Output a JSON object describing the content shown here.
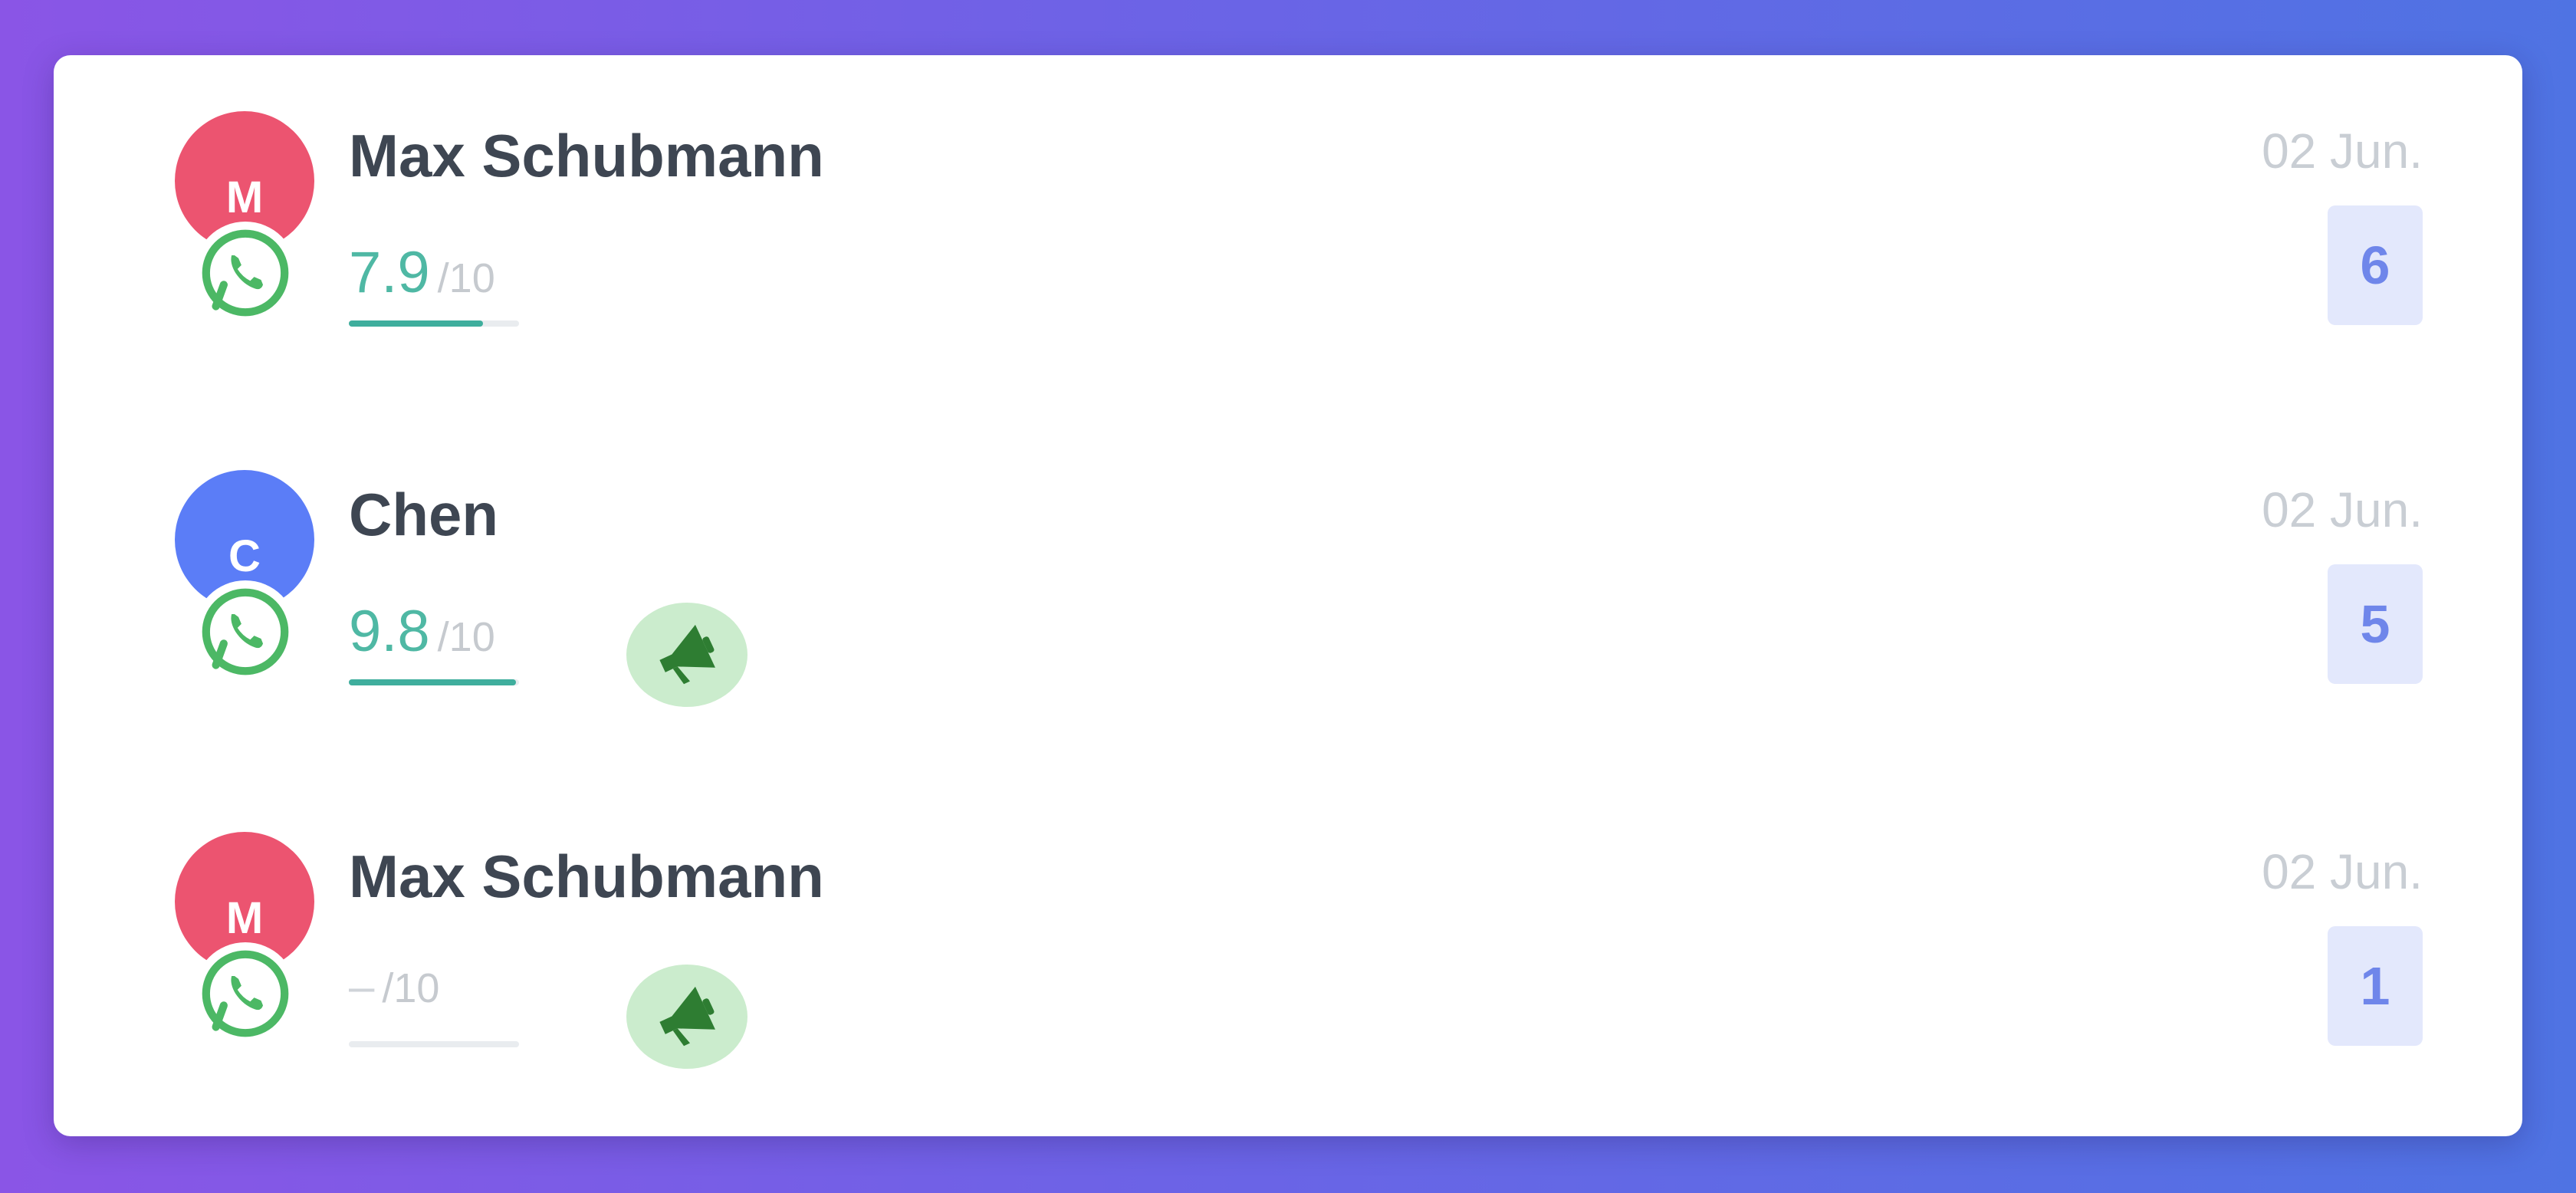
{
  "conversations": [
    {
      "avatar_initial": "M",
      "avatar_color": "#ec5470",
      "channel_icon": "whatsapp-icon",
      "name": "Max Schubmann",
      "score": "7.9",
      "score_max": "/10",
      "score_fraction": 0.79,
      "has_campaign": false,
      "date": "02 Jun.",
      "count": "6"
    },
    {
      "avatar_initial": "C",
      "avatar_color": "#5b7df7",
      "channel_icon": "whatsapp-icon",
      "name": "Chen",
      "score": "9.8",
      "score_max": "/10",
      "score_fraction": 0.98,
      "has_campaign": true,
      "campaign_icon": "megaphone-icon",
      "date": "02 Jun.",
      "count": "5"
    },
    {
      "avatar_initial": "M",
      "avatar_color": "#ec5470",
      "channel_icon": "whatsapp-icon",
      "name": "Max Schubmann",
      "score": "–",
      "score_max": "/10",
      "score_fraction": 0,
      "has_campaign": true,
      "campaign_icon": "megaphone-icon",
      "date": "02 Jun.",
      "count": "1"
    }
  ],
  "colors": {
    "whatsapp_green": "#4cb865",
    "score_teal": "#4fb8a4",
    "count_badge_bg": "#e3e8fc",
    "count_badge_text": "#6f86ea",
    "campaign_bg": "#cbeccd",
    "campaign_icon": "#2e7d32"
  }
}
